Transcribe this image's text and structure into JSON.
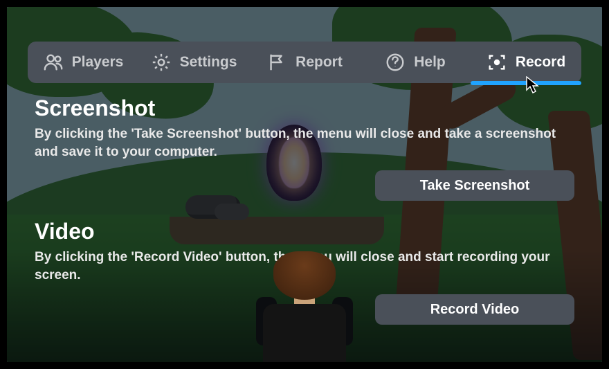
{
  "tabs": {
    "players": "Players",
    "settings": "Settings",
    "report": "Report",
    "help": "Help",
    "record": "Record",
    "active": "record"
  },
  "screenshot": {
    "title": "Screenshot",
    "desc": "By clicking the 'Take Screenshot' button, the menu will close and take a screenshot and save it to your computer.",
    "button": "Take Screenshot"
  },
  "video": {
    "title": "Video",
    "desc": "By clicking the 'Record Video' button, the menu will close and start recording your screen.",
    "button": "Record Video"
  },
  "colors": {
    "accent": "#20a3ff",
    "panel": "#4a5059"
  }
}
